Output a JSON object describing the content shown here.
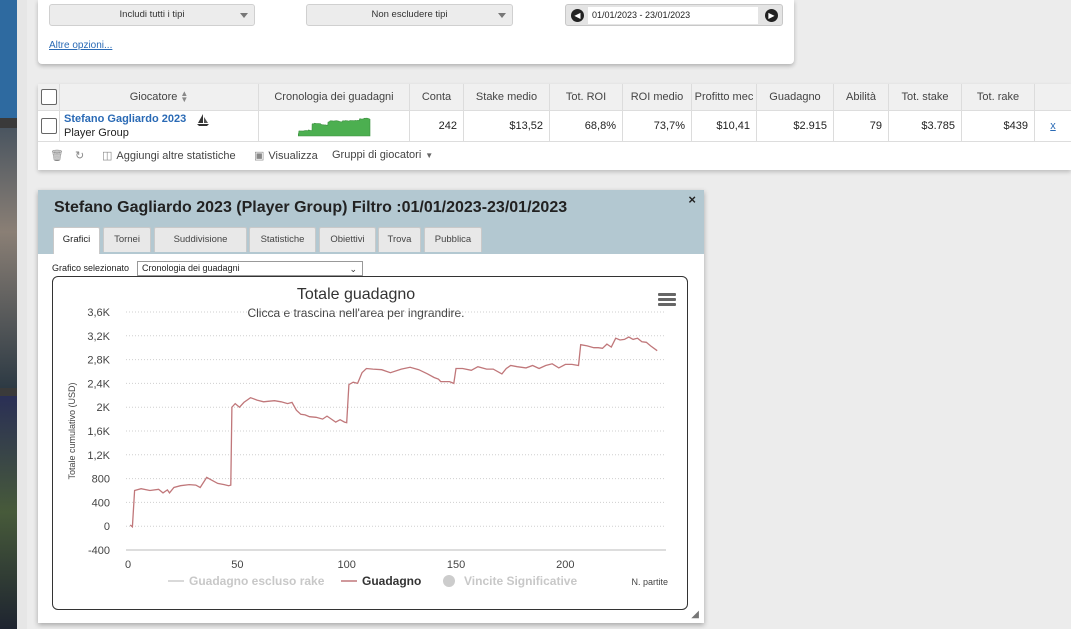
{
  "filters": {
    "include_types": "Includi tutti i tipi",
    "exclude_types": "Non escludere tipi",
    "date_range": "01/01/2023 - 23/01/2023",
    "more_options": "Altre opzioni..."
  },
  "table": {
    "headers": [
      "Giocatore",
      "Cronologia dei guadagni",
      "Conta",
      "Stake medio",
      "Tot. ROI",
      "ROI medio",
      "Profitto mec",
      "Guadagno",
      "Abilità",
      "Tot. stake",
      "Tot. rake"
    ],
    "row": {
      "player_name": "Stefano Gagliardo 2023",
      "player_sub": "Player Group",
      "values": [
        "242",
        "$13,52",
        "68,8%",
        "73,7%",
        "$10,41",
        "$2.915",
        "79",
        "$3.785",
        "$439"
      ],
      "remove": "x"
    },
    "sort_icon": "sort-icon",
    "actions": {
      "add_stats": "Aggiungi altre statistiche",
      "view": "Visualizza",
      "groups": "Gruppi di giocatori"
    }
  },
  "window": {
    "title": "Stefano Gagliardo 2023 (Player Group) Filtro :01/01/2023-23/01/2023",
    "close": "×",
    "tabs": [
      "Grafici",
      "Tornei",
      "Suddivisione",
      "Statistiche",
      "Obiettivi",
      "Trova",
      "Pubblica"
    ],
    "active_tab": "Grafici",
    "graph_label": "Grafico selezionato",
    "graph_value": "Cronologia dei guadagni"
  },
  "chart_data": {
    "type": "line",
    "title": "Totale guadagno",
    "subtitle": "Clicca e trascina nell'area per ingrandire.",
    "ylabel": "Totale cumulativo (USD)",
    "xlabel": "N. partite",
    "ylim": [
      -400,
      3600
    ],
    "xlim": [
      0,
      242
    ],
    "y_ticks": [
      "-400",
      "0",
      "400",
      "800",
      "1,2K",
      "1,6K",
      "2K",
      "2,4K",
      "2,8K",
      "3,2K",
      "3,6K"
    ],
    "x_ticks": [
      "0",
      "50",
      "100",
      "150",
      "200"
    ],
    "grid": "horizontal-dotted",
    "legend": [
      {
        "name": "Guadagno escluso rake",
        "active": false
      },
      {
        "name": "Guadagno",
        "active": true
      },
      {
        "name": "Vincite Significative",
        "active": false
      }
    ],
    "colors": {
      "line": "#c0777a",
      "title": "#333333"
    },
    "series": [
      {
        "name": "Guadagno",
        "points": [
          [
            1,
            20
          ],
          [
            2,
            -10
          ],
          [
            3,
            600
          ],
          [
            6,
            630
          ],
          [
            10,
            600
          ],
          [
            14,
            620
          ],
          [
            16,
            560
          ],
          [
            18,
            610
          ],
          [
            19,
            560
          ],
          [
            21,
            650
          ],
          [
            24,
            680
          ],
          [
            28,
            700
          ],
          [
            31,
            690
          ],
          [
            33,
            650
          ],
          [
            36,
            820
          ],
          [
            38,
            780
          ],
          [
            41,
            720
          ],
          [
            44,
            700
          ],
          [
            46,
            680
          ],
          [
            47,
            690
          ],
          [
            47.5,
            2000
          ],
          [
            49,
            2060
          ],
          [
            51,
            2000
          ],
          [
            53,
            2080
          ],
          [
            56,
            2160
          ],
          [
            59,
            2120
          ],
          [
            62,
            2090
          ],
          [
            64,
            2100
          ],
          [
            67,
            2110
          ],
          [
            70,
            2090
          ],
          [
            73,
            2060
          ],
          [
            75,
            2080
          ],
          [
            77,
            1950
          ],
          [
            79,
            1880
          ],
          [
            81,
            1870
          ],
          [
            83,
            1840
          ],
          [
            86,
            1830
          ],
          [
            89,
            1800
          ],
          [
            91,
            1850
          ],
          [
            93,
            1800
          ],
          [
            95,
            1750
          ],
          [
            97,
            1790
          ],
          [
            99,
            1750
          ],
          [
            100,
            1740
          ],
          [
            101,
            2380
          ],
          [
            103,
            2420
          ],
          [
            105,
            2400
          ],
          [
            107,
            2580
          ],
          [
            109,
            2650
          ],
          [
            112,
            2640
          ],
          [
            116,
            2630
          ],
          [
            120,
            2580
          ],
          [
            125,
            2640
          ],
          [
            129,
            2670
          ],
          [
            133,
            2630
          ],
          [
            137,
            2560
          ],
          [
            140,
            2500
          ],
          [
            142,
            2470
          ],
          [
            143,
            2430
          ],
          [
            147,
            2430
          ],
          [
            149,
            2400
          ],
          [
            150,
            2650
          ],
          [
            153,
            2650
          ],
          [
            157,
            2620
          ],
          [
            160,
            2680
          ],
          [
            164,
            2640
          ],
          [
            167,
            2640
          ],
          [
            171,
            2560
          ],
          [
            173,
            2650
          ],
          [
            175,
            2700
          ],
          [
            178,
            2680
          ],
          [
            182,
            2660
          ],
          [
            185,
            2700
          ],
          [
            188,
            2650
          ],
          [
            191,
            2700
          ],
          [
            194,
            2730
          ],
          [
            197,
            2660
          ],
          [
            200,
            2720
          ],
          [
            203,
            2720
          ],
          [
            206,
            2700
          ],
          [
            207,
            3050
          ],
          [
            210,
            3030
          ],
          [
            213,
            3000
          ],
          [
            215,
            3000
          ],
          [
            217,
            2990
          ],
          [
            219,
            3060
          ],
          [
            221,
            3010
          ],
          [
            223,
            3160
          ],
          [
            225,
            3130
          ],
          [
            227,
            3140
          ],
          [
            229,
            3180
          ],
          [
            231,
            3140
          ],
          [
            233,
            3160
          ],
          [
            235,
            3100
          ],
          [
            237,
            3090
          ],
          [
            239,
            3030
          ],
          [
            242,
            2950
          ]
        ]
      }
    ]
  }
}
